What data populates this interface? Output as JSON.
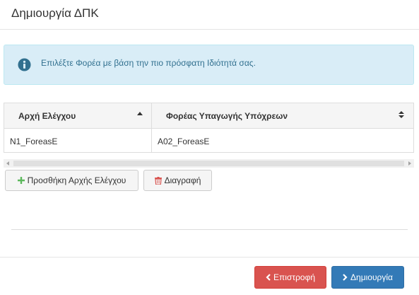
{
  "modal": {
    "title": "Δημιουργία ΔΠΚ"
  },
  "alert": {
    "text": "Επιλέξτε Φορέα με βάση την πιο πρόσφατη Ιδιότητά σας.",
    "icon": "info-circle-icon",
    "color": "#31708f",
    "background": "#d9edf7"
  },
  "grid": {
    "columns": [
      {
        "label": "Αρχή Ελέγχου",
        "sort": "ascending"
      },
      {
        "label": "Φορέας Υπαγωγής Υπόχρεων",
        "sort": "none"
      }
    ],
    "rows": [
      [
        "N1_ForeasE",
        "A02_ForeasE"
      ]
    ]
  },
  "actions": {
    "add_label": "Προσθήκη Αρχής Ελέγχου",
    "delete_label": "Διαγραφή"
  },
  "footer": {
    "back_label": "Επιστροφή",
    "create_label": "Δημιουργία",
    "back_color": "#d9534f",
    "create_color": "#337ab7"
  }
}
